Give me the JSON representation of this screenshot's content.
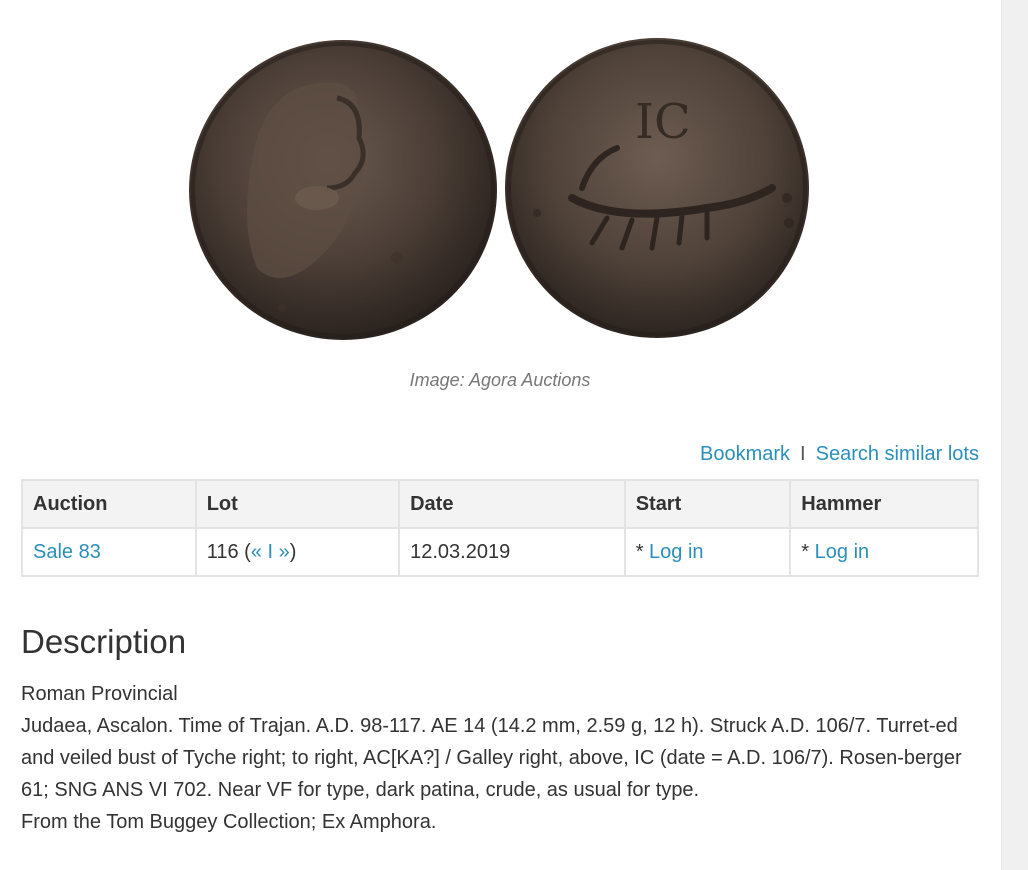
{
  "image": {
    "caption": "Image: Agora Auctions",
    "obverse_letters": "",
    "reverse_letters": "IC"
  },
  "actions": {
    "bookmark": "Bookmark",
    "separator": "I",
    "search_similar": "Search similar lots"
  },
  "table": {
    "headers": [
      "Auction",
      "Lot",
      "Date",
      "Start",
      "Hammer"
    ],
    "row": {
      "auction": "Sale 83",
      "lot_number": "116 (",
      "prev": "«",
      "divider": " I ",
      "next": "»",
      "lot_close": ")",
      "date": "12.03.2019",
      "start_prefix": "* ",
      "start_link": "Log in",
      "hammer_prefix": "* ",
      "hammer_link": "Log in"
    }
  },
  "description": {
    "title": "Description",
    "category": "Roman Provincial",
    "text": "Judaea, Ascalon. Time of Trajan. A.D. 98-117. AE 14 (14.2 mm, 2.59 g, 12 h). Struck A.D. 106/7. Turret-ed and veiled bust of Tyche right; to right, AC[KA?] / Galley right, above, IC (date = A.D. 106/7). Rosen-berger 61; SNG ANS VI 702. Near VF for type, dark patina, crude, as usual for type.",
    "provenance": "From the Tom Buggey Collection; Ex Amphora."
  },
  "colors": {
    "link": "#2a8fbd",
    "header_bg": "#f3f3f3",
    "border": "#e3e3e3",
    "coin_dark": "#3a2f29",
    "coin_mid": "#5a4a40"
  }
}
